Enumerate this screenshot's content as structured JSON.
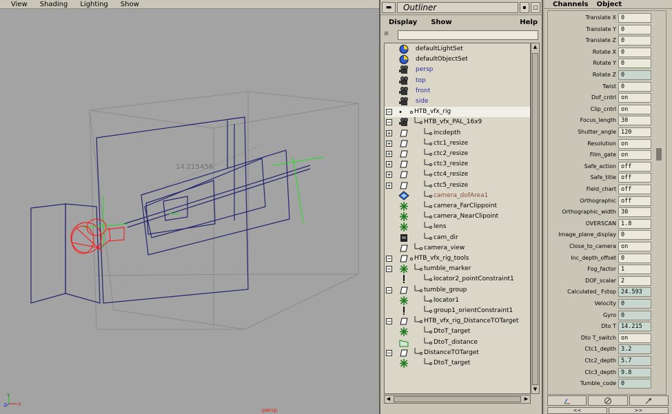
{
  "viewport": {
    "menu": [
      "View",
      "Shading",
      "Lighting",
      "Show"
    ],
    "distance_readout": "14.215456",
    "camera_label": "persp",
    "axis": {
      "y": "Y",
      "z": "Z",
      "x": "X"
    }
  },
  "outliner": {
    "title": "Outliner",
    "menu": [
      "Display",
      "Show",
      "Help"
    ],
    "nodes": [
      {
        "label": "defaultLightSet",
        "depth": 0,
        "expander": "",
        "icon": "set-icon",
        "color": "normal"
      },
      {
        "label": "defaultObjectSet",
        "depth": 0,
        "expander": "",
        "icon": "set-icon",
        "color": "normal"
      },
      {
        "label": "persp",
        "depth": 0,
        "expander": "",
        "icon": "camera-icon",
        "color": "blue"
      },
      {
        "label": "top",
        "depth": 0,
        "expander": "",
        "icon": "camera-icon",
        "color": "blue"
      },
      {
        "label": "front",
        "depth": 0,
        "expander": "",
        "icon": "camera-icon",
        "color": "blue"
      },
      {
        "label": "side",
        "depth": 0,
        "expander": "",
        "icon": "camera-icon",
        "color": "blue"
      },
      {
        "label": "HTB_vfx_rig",
        "depth": 0,
        "expander": "−",
        "icon": "group-icon",
        "color": "normal",
        "selected": true
      },
      {
        "label": "HTB_vfx_PAL_16x9",
        "depth": 1,
        "expander": "−",
        "icon": "camera-icon",
        "color": "normal"
      },
      {
        "label": "incdepth",
        "depth": 2,
        "expander": "+",
        "icon": "plane-icon",
        "color": "normal"
      },
      {
        "label": "ctc1_resize",
        "depth": 2,
        "expander": "+",
        "icon": "plane-icon",
        "color": "normal"
      },
      {
        "label": "ctc2_resize",
        "depth": 2,
        "expander": "+",
        "icon": "plane-icon",
        "color": "normal"
      },
      {
        "label": "ctc3_resize",
        "depth": 2,
        "expander": "+",
        "icon": "plane-icon",
        "color": "normal"
      },
      {
        "label": "ctc4_resize",
        "depth": 2,
        "expander": "+",
        "icon": "plane-icon",
        "color": "normal"
      },
      {
        "label": "ctc5_resize",
        "depth": 2,
        "expander": "+",
        "icon": "plane-icon",
        "color": "normal"
      },
      {
        "label": "camera_dofArea1",
        "depth": 2,
        "expander": "",
        "icon": "shape-icon",
        "color": "brown"
      },
      {
        "label": "camera_FarClippoint",
        "depth": 2,
        "expander": "",
        "icon": "locator-icon",
        "color": "normal"
      },
      {
        "label": "camera_NearClipoint",
        "depth": 2,
        "expander": "",
        "icon": "locator-icon",
        "color": "normal"
      },
      {
        "label": "lens",
        "depth": 2,
        "expander": "",
        "icon": "locator-icon",
        "color": "normal"
      },
      {
        "label": "cam_dir",
        "depth": 2,
        "expander": "",
        "icon": "cam-shape-icon",
        "color": "normal"
      },
      {
        "label": "camera_view",
        "depth": 1,
        "expander": "",
        "icon": "plane-icon",
        "color": "normal"
      },
      {
        "label": "HTB_vfx_rig_tools",
        "depth": 0,
        "expander": "−",
        "icon": "plane-icon",
        "color": "normal"
      },
      {
        "label": "tumble_marker",
        "depth": 1,
        "expander": "−",
        "icon": "locator-icon",
        "color": "normal"
      },
      {
        "label": "locator2_pointConstraint1",
        "depth": 2,
        "expander": "",
        "icon": "constraint-icon",
        "color": "normal"
      },
      {
        "label": "tumble_group",
        "depth": 1,
        "expander": "−",
        "icon": "plane-icon",
        "color": "normal"
      },
      {
        "label": "locator1",
        "depth": 2,
        "expander": "",
        "icon": "locator-icon",
        "color": "normal"
      },
      {
        "label": "group1_orientConstraint1",
        "depth": 2,
        "expander": "",
        "icon": "constraint-icon",
        "color": "normal"
      },
      {
        "label": "HTB_vfx_rig_DistanceTOTarget",
        "depth": 1,
        "expander": "−",
        "icon": "plane-icon",
        "color": "normal"
      },
      {
        "label": "DtoT_target",
        "depth": 2,
        "expander": "",
        "icon": "locator-icon",
        "color": "normal"
      },
      {
        "label": "DtoT_distance",
        "depth": 2,
        "expander": "",
        "icon": "distance-icon",
        "color": "normal"
      },
      {
        "label": "DistanceTOTarget",
        "depth": 1,
        "expander": "−",
        "icon": "plane-icon",
        "color": "normal"
      },
      {
        "label": "DtoT_target",
        "depth": 2,
        "expander": "",
        "icon": "locator-icon",
        "color": "normal"
      }
    ]
  },
  "channels": {
    "menu": [
      "Channels",
      "Object"
    ],
    "attributes": [
      {
        "name": "Translate X",
        "value": "0"
      },
      {
        "name": "Translate Y",
        "value": "0"
      },
      {
        "name": "Translate Z",
        "value": "0"
      },
      {
        "name": "Rotate X",
        "value": "0"
      },
      {
        "name": "Rotate Y",
        "value": "0"
      },
      {
        "name": "Rotate Z",
        "value": "0",
        "locked": true
      },
      {
        "name": "Twist",
        "value": "0"
      },
      {
        "name": "Dof_cntrl",
        "value": "on"
      },
      {
        "name": "Clip_cntrl",
        "value": "on"
      },
      {
        "name": "Focus_length",
        "value": "30"
      },
      {
        "name": "Shutter_angle",
        "value": "120"
      },
      {
        "name": "Resolution",
        "value": "on"
      },
      {
        "name": "Film_gate",
        "value": "on"
      },
      {
        "name": "Safe_action",
        "value": "off"
      },
      {
        "name": "Safe_title",
        "value": "off"
      },
      {
        "name": "Field_chart",
        "value": "off"
      },
      {
        "name": "Orthographic",
        "value": "off"
      },
      {
        "name": "Orthographic_width",
        "value": "30"
      },
      {
        "name": "OVERSCAN",
        "value": "1.8"
      },
      {
        "name": "Image_plane_display",
        "value": "0"
      },
      {
        "name": "Close_to_camera",
        "value": "on"
      },
      {
        "name": "Inc_depth_offset",
        "value": "0"
      },
      {
        "name": "Fog_factor",
        "value": "1"
      },
      {
        "name": "DOF_scalar",
        "value": "2"
      },
      {
        "name": "Calculated_ Fstop",
        "value": "24.593",
        "locked": true
      },
      {
        "name": "Velocity",
        "value": "0",
        "locked": true
      },
      {
        "name": "Gyro",
        "value": "0",
        "locked": true
      },
      {
        "name": "Dto T",
        "value": "14.215",
        "locked": true
      },
      {
        "name": "Dto T_switch",
        "value": "on"
      },
      {
        "name": "Ctc1_depth",
        "value": "3.2",
        "locked": true
      },
      {
        "name": "Ctc2_depth",
        "value": "5.7",
        "locked": true
      },
      {
        "name": "Ctc3_depth",
        "value": "9.8",
        "locked": true
      },
      {
        "name": "Tumble_code",
        "value": "0",
        "locked": true
      }
    ],
    "nav": [
      "<<",
      ">>"
    ]
  }
}
